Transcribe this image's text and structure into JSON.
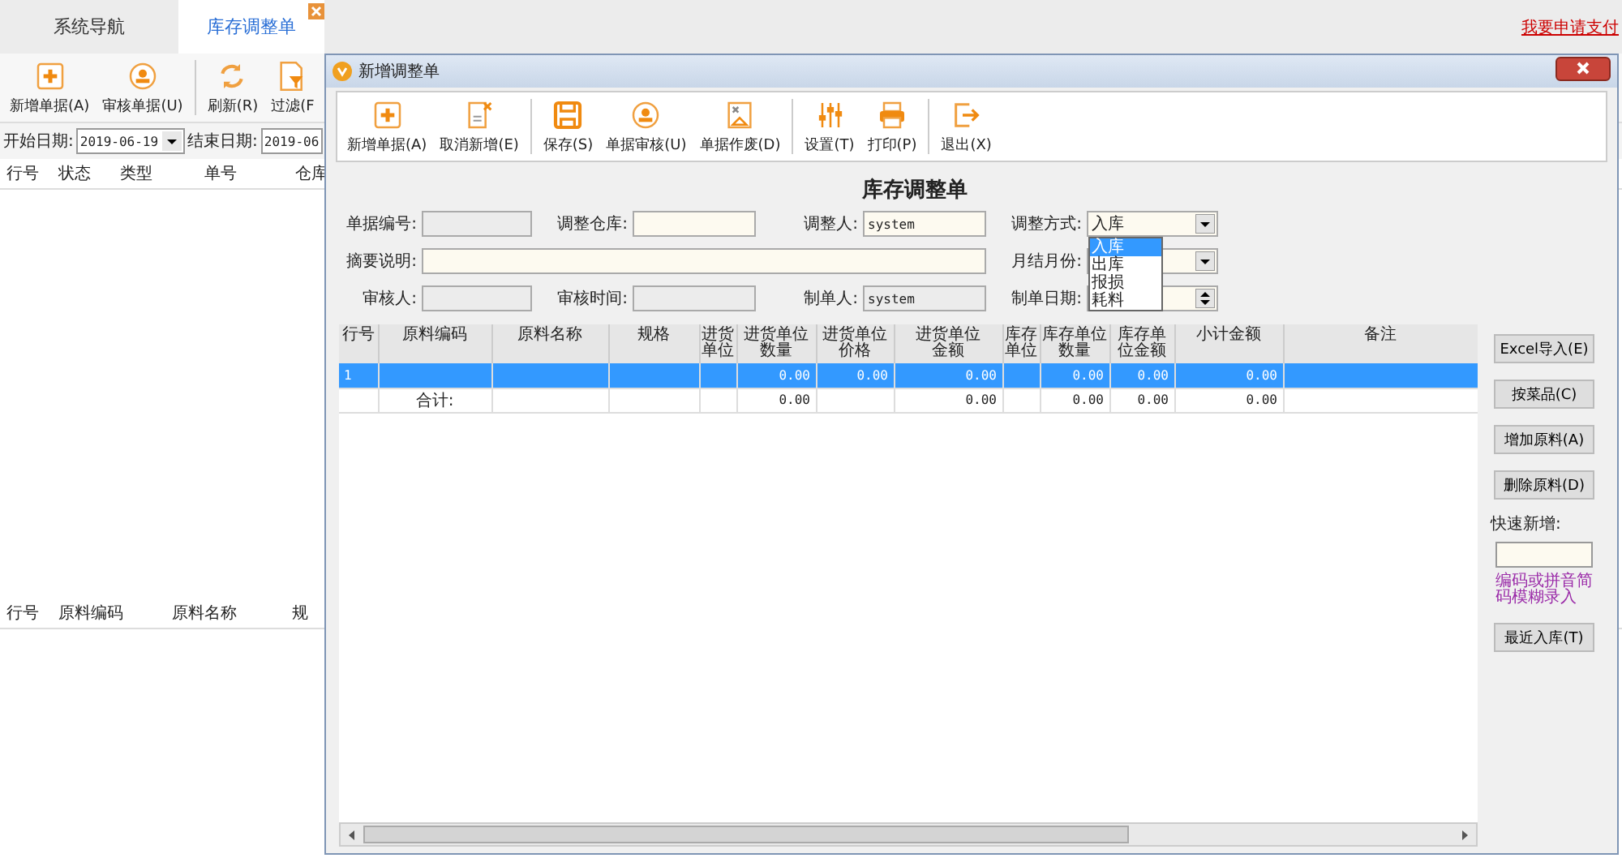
{
  "app": {
    "tabs": [
      {
        "label": "系统导航",
        "selected": false
      },
      {
        "label": "库存调整单",
        "selected": true
      }
    ],
    "link": "我要申请支付",
    "toolbar": [
      {
        "label": "新增单据(A)",
        "kind": "add"
      },
      {
        "label": "审核单据(U)",
        "kind": "audit"
      },
      {
        "label": "刷新(R)",
        "kind": "refresh"
      },
      {
        "label": "过滤(F",
        "kind": "filter"
      }
    ],
    "filter": {
      "start_label": "开始日期:",
      "start_value": "2019-06-19",
      "end_label": "结束日期:",
      "end_value": "2019-06"
    },
    "list_columns": [
      "行号",
      "状态",
      "类型",
      "单号",
      "仓库"
    ],
    "detail_columns": [
      "行号",
      "原料编码",
      "原料名称",
      "规"
    ]
  },
  "dialog": {
    "title": "新增调整单",
    "toolbar": [
      {
        "label": "新增单据(A)",
        "kind": "add"
      },
      {
        "label": "取消新增(E)",
        "kind": "cancel"
      },
      {
        "label": "保存(S)",
        "kind": "save"
      },
      {
        "label": "单据审核(U)",
        "kind": "audit"
      },
      {
        "label": "单据作废(D)",
        "kind": "void"
      },
      {
        "label": "设置(T)",
        "kind": "settings"
      },
      {
        "label": "打印(P)",
        "kind": "print"
      },
      {
        "label": "退出(X)",
        "kind": "exit"
      }
    ],
    "form_title": "库存调整单",
    "form_rows": [
      [
        {
          "label": "单据编号:",
          "kind": "text",
          "disabled": true
        },
        {
          "label": "调整仓库:",
          "kind": "text",
          "disabled": false
        },
        {
          "label": "调整人:",
          "kind": "text",
          "disabled": false,
          "value": "system"
        },
        {
          "label": "调整方式:",
          "kind": "select",
          "disabled": false,
          "value": "入库",
          "expanded": true,
          "options": [
            {
              "label": "入库",
              "selected": true
            },
            {
              "label": "出库",
              "selected": false
            },
            {
              "label": "报损",
              "selected": false
            },
            {
              "label": "耗料",
              "selected": false
            }
          ]
        }
      ],
      [
        {
          "label": "摘要说明:",
          "kind": "wide",
          "disabled": false
        },
        {
          "label": "月结月份:",
          "kind": "select",
          "disabled": false
        }
      ],
      [
        {
          "label": "审核人:",
          "kind": "text",
          "disabled": true
        },
        {
          "label": "审核时间:",
          "kind": "text",
          "disabled": true
        },
        {
          "label": "制单人:",
          "kind": "text",
          "disabled": true,
          "value": "system"
        },
        {
          "label": "制单日期:",
          "kind": "spin",
          "disabled": false
        }
      ]
    ],
    "grid": {
      "columns": [
        "行号",
        "原料编码",
        "原料名称",
        "规格",
        "进货单位",
        "进货单位数量",
        "进货单位价格",
        "进货单位金额",
        "库存单位",
        "库存单位数量",
        "库存单位金额",
        "小计金额",
        "备注"
      ],
      "rows": [
        {
          "selected": true,
          "cells": [
            "1",
            "",
            "",
            "",
            "",
            "0.00",
            "0.00",
            "0.00",
            "",
            "0.00",
            "0.00",
            "0.00",
            ""
          ]
        },
        {
          "selected": false,
          "cells": [
            "",
            "合计:",
            "",
            "",
            "",
            "0.00",
            "",
            "0.00",
            "",
            "0.00",
            "0.00",
            "0.00",
            ""
          ]
        }
      ]
    },
    "side": {
      "buttons": [
        "Excel导入(E)",
        "按菜品(C)",
        "增加原料(A)",
        "删除原料(D)"
      ],
      "quick_label": "快速新增:",
      "hint": "编码或拼音简码模糊录入",
      "last_button": "最近入库(T)"
    }
  }
}
